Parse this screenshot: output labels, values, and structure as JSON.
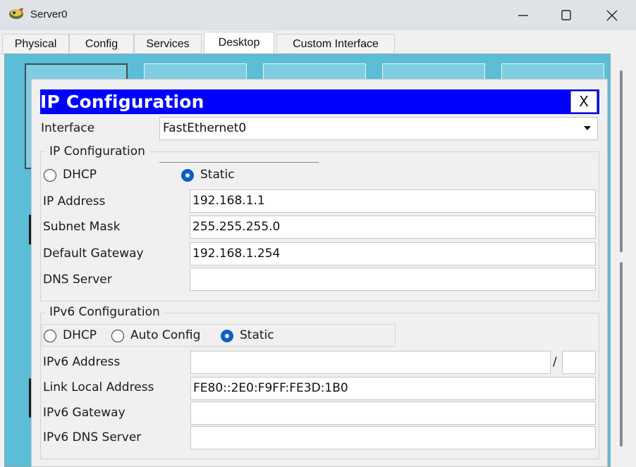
{
  "window": {
    "title": "Server0"
  },
  "tabs": [
    {
      "label": "Physical"
    },
    {
      "label": "Config"
    },
    {
      "label": "Services"
    },
    {
      "label": "Desktop"
    },
    {
      "label": "Custom Interface"
    }
  ],
  "active_tab": "Desktop",
  "ip_config": {
    "title": "IP Configuration",
    "close_label": "X",
    "interface_label": "Interface",
    "interface_value": "FastEthernet0",
    "ipv4": {
      "group_label": "IP Configuration",
      "dhcp_label": "DHCP",
      "static_label": "Static",
      "selected": "Static",
      "ip_address_label": "IP Address",
      "ip_address": "192.168.1.1",
      "subnet_mask_label": "Subnet Mask",
      "subnet_mask": "255.255.255.0",
      "default_gateway_label": "Default Gateway",
      "default_gateway": "192.168.1.254",
      "dns_server_label": "DNS Server",
      "dns_server": ""
    },
    "ipv6": {
      "group_label": "IPv6 Configuration",
      "dhcp_label": "DHCP",
      "auto_config_label": "Auto Config",
      "static_label": "Static",
      "selected": "Static",
      "ipv6_address_label": "IPv6 Address",
      "ipv6_address": "",
      "prefix_separator": "/",
      "prefix_length": "",
      "link_local_label": "Link Local Address",
      "link_local": "FE80::2E0:F9FF:FE3D:1B0",
      "ipv6_gateway_label": "IPv6 Gateway",
      "ipv6_gateway": "",
      "ipv6_dns_label": "IPv6 DNS Server",
      "ipv6_dns": ""
    }
  },
  "colors": {
    "header_blue": "#0000ff",
    "desktop_teal": "#5bbdd6",
    "radio_selected": "#0a5fc8"
  },
  "icons": [
    "server-app-icon",
    "minimize-icon",
    "maximize-icon",
    "close-icon",
    "dropdown-caret-icon"
  ]
}
